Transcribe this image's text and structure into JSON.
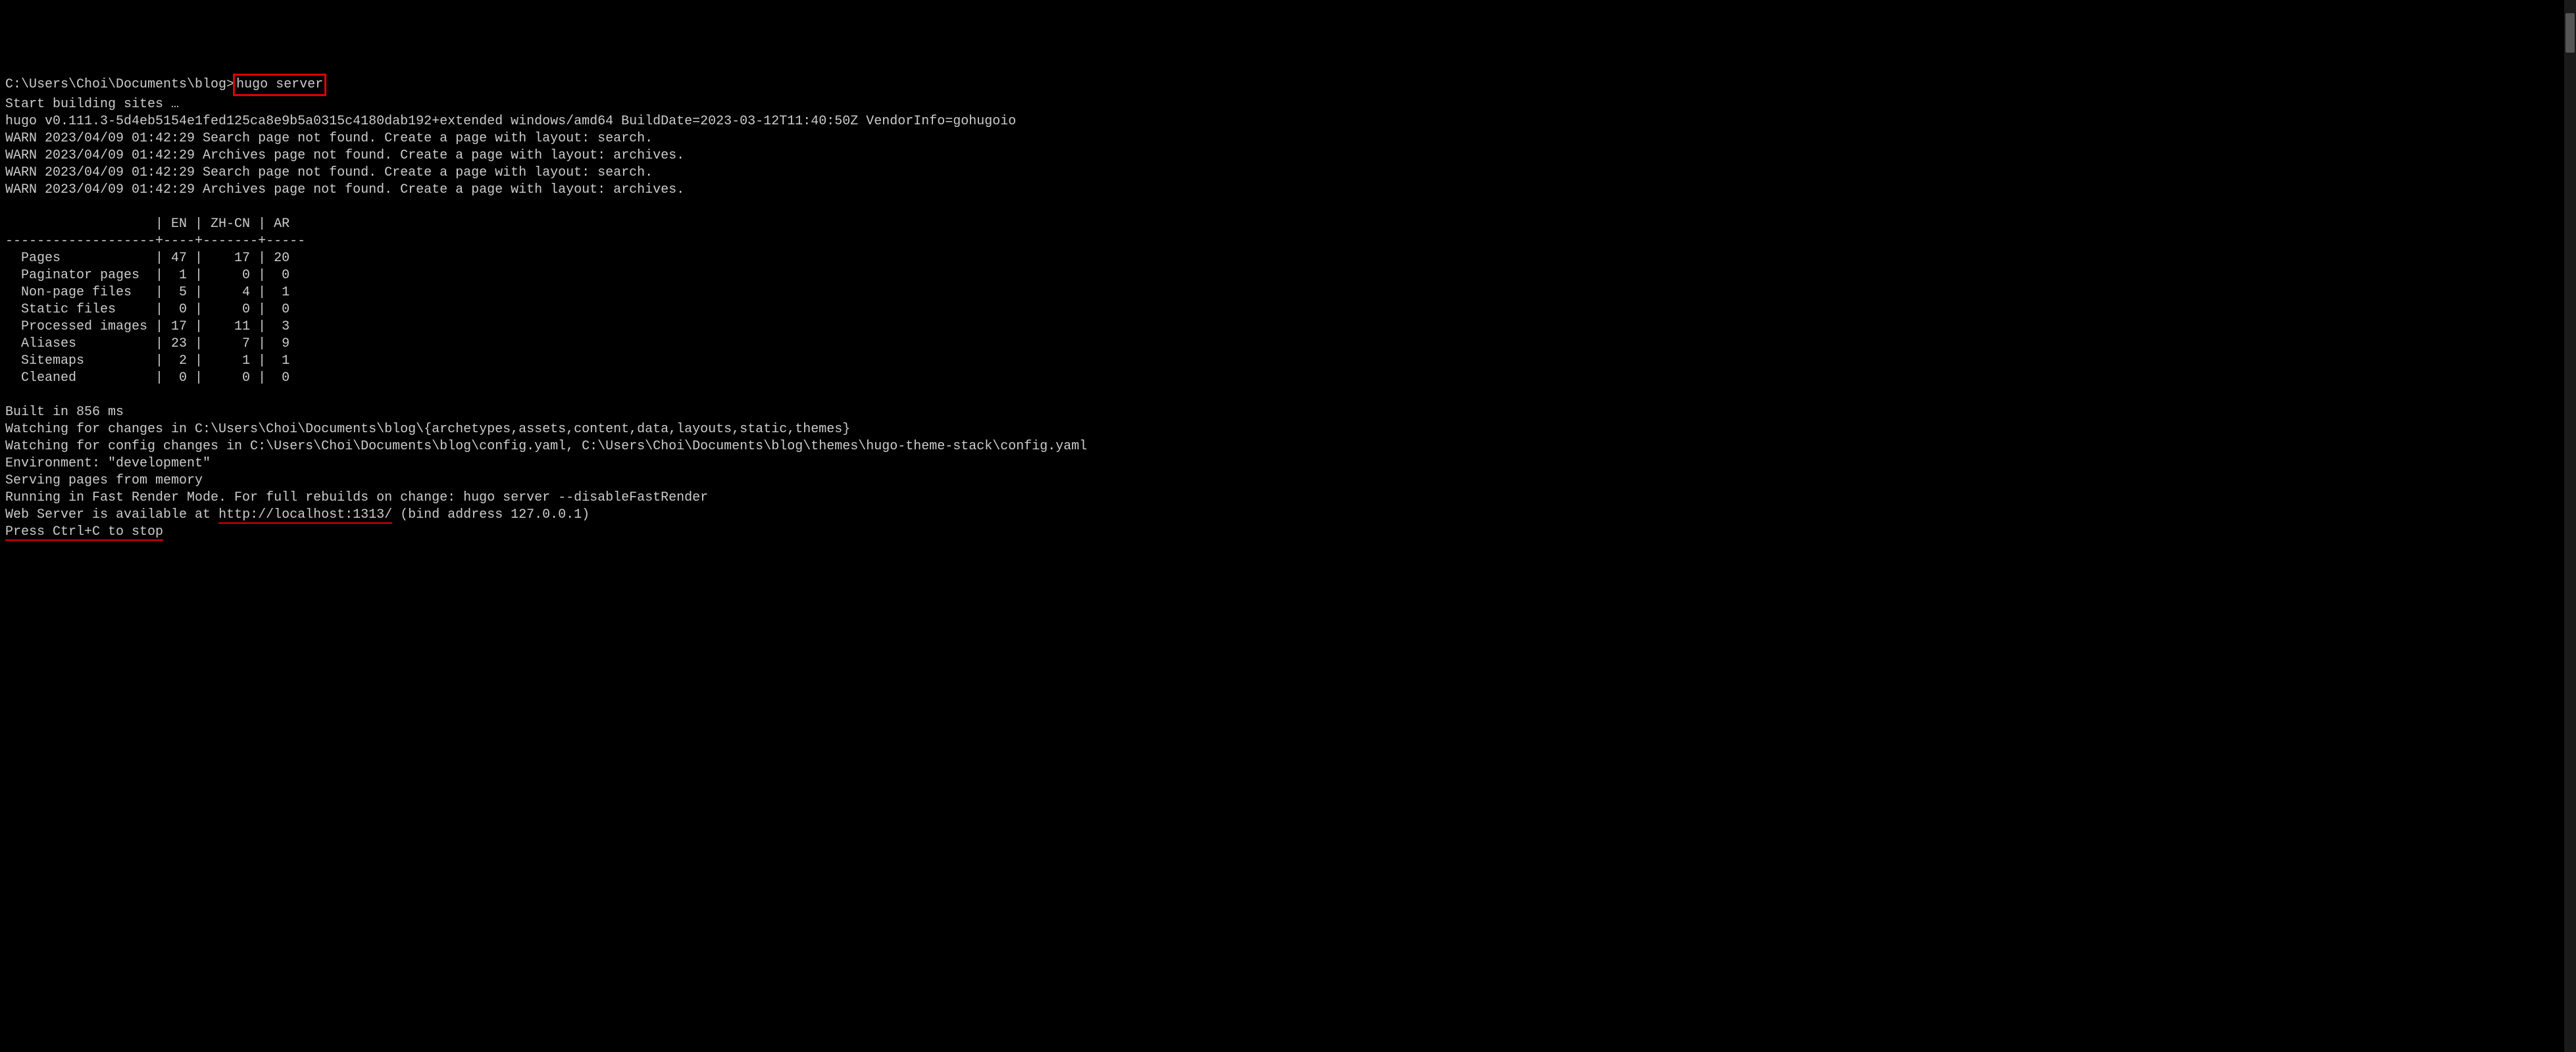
{
  "prompt": {
    "path": "C:\\Users\\Choi\\Documents\\blog>",
    "command": "hugo server"
  },
  "output": {
    "start_building": "Start building sites …",
    "hugo_version": "hugo v0.111.3-5d4eb5154e1fed125ca8e9b5a0315c4180dab192+extended windows/amd64 BuildDate=2023-03-12T11:40:50Z VendorInfo=gohugoio",
    "warnings": [
      "WARN 2023/04/09 01:42:29 Search page not found. Create a page with layout: search.",
      "WARN 2023/04/09 01:42:29 Archives page not found. Create a page with layout: archives.",
      "WARN 2023/04/09 01:42:29 Search page not found. Create a page with layout: search.",
      "WARN 2023/04/09 01:42:29 Archives page not found. Create a page with layout: archives."
    ],
    "table": {
      "header": "                   | EN | ZH-CN | AR  ",
      "divider": "-------------------+----+-------+-----",
      "rows": [
        "  Pages            | 47 |    17 | 20  ",
        "  Paginator pages  |  1 |     0 |  0  ",
        "  Non-page files   |  5 |     4 |  1  ",
        "  Static files     |  0 |     0 |  0  ",
        "  Processed images | 17 |    11 |  3  ",
        "  Aliases          | 23 |     7 |  9  ",
        "  Sitemaps         |  2 |     1 |  1  ",
        "  Cleaned          |  0 |     0 |  0  "
      ]
    },
    "built_in": "Built in 856 ms",
    "watching_changes": "Watching for changes in C:\\Users\\Choi\\Documents\\blog\\{archetypes,assets,content,data,layouts,static,themes}",
    "watching_config": "Watching for config changes in C:\\Users\\Choi\\Documents\\blog\\config.yaml, C:\\Users\\Choi\\Documents\\blog\\themes\\hugo-theme-stack\\config.yaml",
    "environment": "Environment: \"development\"",
    "serving": "Serving pages from memory",
    "fast_render": "Running in Fast Render Mode. For full rebuilds on change: hugo server --disableFastRender",
    "web_server_prefix": "Web Server is available at ",
    "web_server_url": "http://localhost:1313/",
    "web_server_suffix": " (bind address 127.0.0.1)",
    "press_ctrl_c": "Press Ctrl+C to stop"
  }
}
